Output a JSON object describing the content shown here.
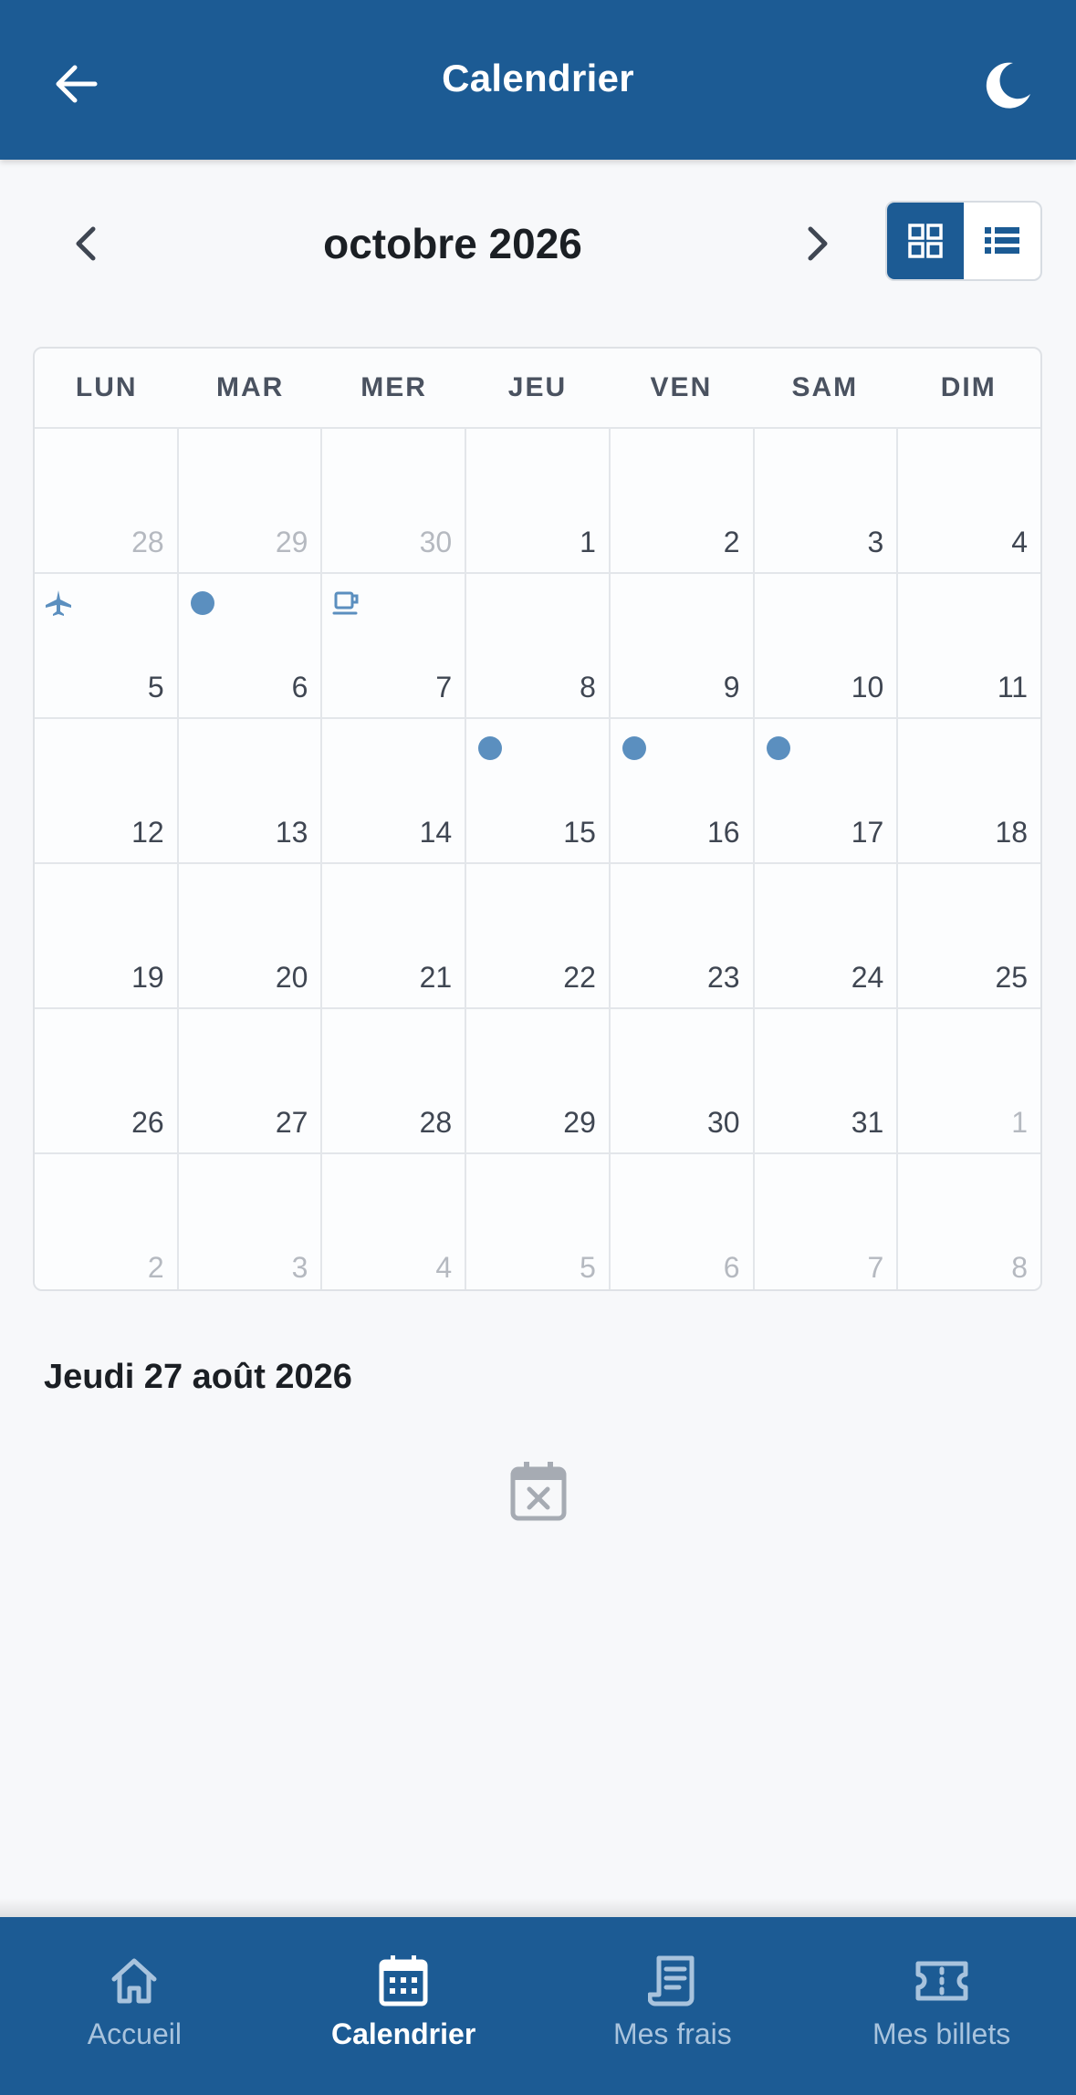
{
  "appbar": {
    "title": "Calendrier",
    "back_icon": "arrow-left-icon",
    "theme_icon": "moon-icon"
  },
  "month_nav": {
    "label": "octobre 2026",
    "prev_icon": "chevron-left-icon",
    "next_icon": "chevron-right-icon",
    "view_modes": [
      {
        "name": "grid-view",
        "icon": "grid-icon",
        "active": true
      },
      {
        "name": "list-view",
        "icon": "list-icon",
        "active": false
      }
    ]
  },
  "calendar": {
    "weekdays": [
      "LUN",
      "MAR",
      "MER",
      "JEU",
      "VEN",
      "SAM",
      "DIM"
    ],
    "weeks": [
      [
        {
          "d": "28",
          "muted": true
        },
        {
          "d": "29",
          "muted": true
        },
        {
          "d": "30",
          "muted": true
        },
        {
          "d": "1"
        },
        {
          "d": "2"
        },
        {
          "d": "3"
        },
        {
          "d": "4"
        }
      ],
      [
        {
          "d": "5",
          "marker": "plane-icon"
        },
        {
          "d": "6",
          "marker": "dot"
        },
        {
          "d": "7",
          "marker": "coffee-icon"
        },
        {
          "d": "8"
        },
        {
          "d": "9"
        },
        {
          "d": "10"
        },
        {
          "d": "11"
        }
      ],
      [
        {
          "d": "12"
        },
        {
          "d": "13"
        },
        {
          "d": "14"
        },
        {
          "d": "15",
          "marker": "dot"
        },
        {
          "d": "16",
          "marker": "dot"
        },
        {
          "d": "17",
          "marker": "dot"
        },
        {
          "d": "18"
        }
      ],
      [
        {
          "d": "19"
        },
        {
          "d": "20"
        },
        {
          "d": "21"
        },
        {
          "d": "22"
        },
        {
          "d": "23"
        },
        {
          "d": "24"
        },
        {
          "d": "25"
        }
      ],
      [
        {
          "d": "26"
        },
        {
          "d": "27"
        },
        {
          "d": "28"
        },
        {
          "d": "29"
        },
        {
          "d": "30"
        },
        {
          "d": "31"
        },
        {
          "d": "1",
          "muted": true
        }
      ],
      [
        {
          "d": "2",
          "muted": true
        },
        {
          "d": "3",
          "muted": true
        },
        {
          "d": "4",
          "muted": true
        },
        {
          "d": "5",
          "muted": true
        },
        {
          "d": "6",
          "muted": true
        },
        {
          "d": "7",
          "muted": true
        },
        {
          "d": "8",
          "muted": true
        }
      ]
    ]
  },
  "selected_day": {
    "label": "Jeudi 27 août 2026",
    "empty_icon": "calendar-empty-icon"
  },
  "bottom_nav": {
    "items": [
      {
        "label": "Accueil",
        "icon": "home-icon",
        "active": false
      },
      {
        "label": "Calendrier",
        "icon": "calendar-icon",
        "active": true
      },
      {
        "label": "Mes frais",
        "icon": "receipt-icon",
        "active": false
      },
      {
        "label": "Mes billets",
        "icon": "ticket-icon",
        "active": false
      }
    ]
  },
  "colors": {
    "primary": "#1c5b94",
    "event_dot": "#5b8fbf",
    "muted_text": "#b5b9c0"
  }
}
